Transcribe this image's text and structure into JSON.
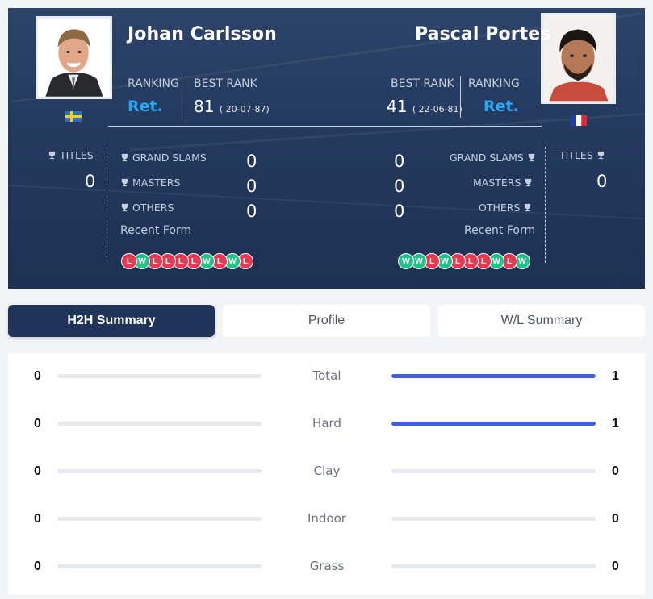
{
  "player1": {
    "name": "Johan Carlsson",
    "ranking_label": "RANKING",
    "ranking": "Ret.",
    "best_rank_label": "BEST RANK",
    "best_rank": "81",
    "best_rank_date": "( 20-07-87)",
    "country_flag": "sweden-flag",
    "titles_label": "TITLES",
    "titles": "0",
    "grand_slams_label": "GRAND SLAMS",
    "grand_slams": "0",
    "masters_label": "MASTERS",
    "masters": "0",
    "others_label": "OTHERS",
    "others": "0",
    "recent_form_label": "Recent Form",
    "recent_form": [
      "L",
      "W",
      "L",
      "L",
      "L",
      "L",
      "W",
      "L",
      "W",
      "L"
    ]
  },
  "player2": {
    "name": "Pascal Portes",
    "ranking_label": "RANKING",
    "ranking": "Ret.",
    "best_rank_label": "BEST RANK",
    "best_rank": "41",
    "best_rank_date": "( 22-06-81)",
    "country_flag": "france-flag",
    "titles_label": "TITLES",
    "titles": "0",
    "grand_slams_label": "GRAND SLAMS",
    "grand_slams": "0",
    "masters_label": "MASTERS",
    "masters": "0",
    "others_label": "OTHERS",
    "others": "0",
    "recent_form_label": "Recent Form",
    "recent_form": [
      "W",
      "W",
      "L",
      "W",
      "L",
      "L",
      "L",
      "W",
      "L",
      "W"
    ]
  },
  "tabs": [
    {
      "label": "H2H Summary",
      "active": true
    },
    {
      "label": "Profile",
      "active": false
    },
    {
      "label": "W/L Summary",
      "active": false
    }
  ],
  "h2h": [
    {
      "label": "Total",
      "p1": 0,
      "p2": 1
    },
    {
      "label": "Hard",
      "p1": 0,
      "p2": 1
    },
    {
      "label": "Clay",
      "p1": 0,
      "p2": 0
    },
    {
      "label": "Indoor",
      "p1": 0,
      "p2": 0
    },
    {
      "label": "Grass",
      "p1": 0,
      "p2": 0
    }
  ],
  "colors": {
    "header_bg": "#243a5e",
    "accent_blue": "#2aa6f5",
    "bar_fill": "#3d5ee0",
    "loss": "#e23a55",
    "win": "#25c18a",
    "active_tab": "#1f3458"
  }
}
